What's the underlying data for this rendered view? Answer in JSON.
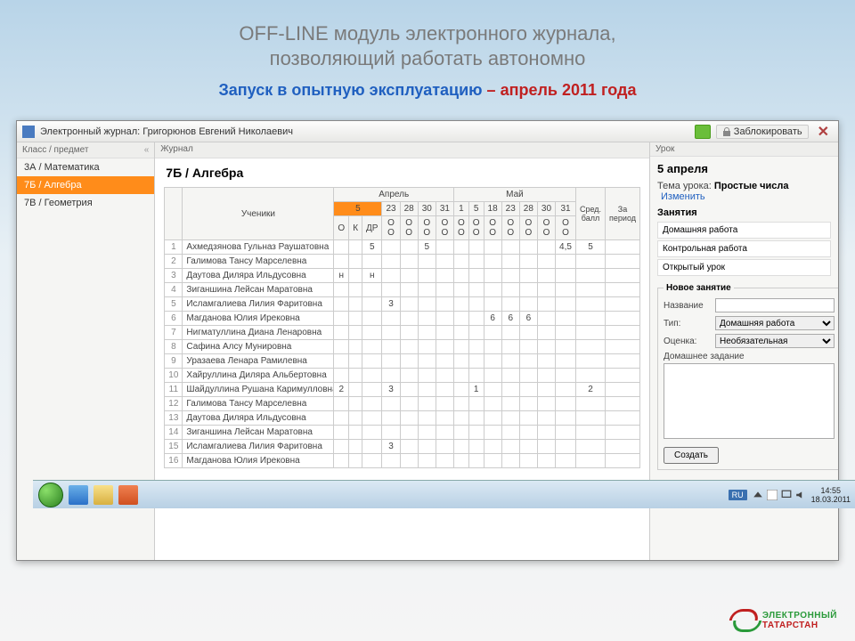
{
  "slide": {
    "title_line1": "OFF-LINE  модуль электронного журнала,",
    "title_line2": "позволяющий работать автономно",
    "subtitle_blue": "Запуск в опытную эксплуатацию",
    "subtitle_sep": " – ",
    "subtitle_red": "апрель 2011 года"
  },
  "app": {
    "title": "Электронный журнал: Григорюнов Евгений Николаевич",
    "lock_btn": "Заблокировать"
  },
  "sidebar": {
    "header": "Класс / предмет",
    "items": [
      {
        "label": "3А / Математика",
        "active": false
      },
      {
        "label": "7Б / Алгебра",
        "active": true
      },
      {
        "label": "7В / Геометрия",
        "active": false
      }
    ]
  },
  "main": {
    "tab_label": "Журнал",
    "title": "7Б / Алгебра",
    "students_header": "Ученики",
    "months": [
      "Апрель",
      "Май"
    ],
    "april_days": [
      "5",
      "23",
      "28",
      "30",
      "31"
    ],
    "may_days": [
      "1",
      "5",
      "18",
      "23",
      "28",
      "30",
      "31"
    ],
    "subhead": {
      "o": "О",
      "k": "К",
      "dr": "ДР",
      "oo": "О О"
    },
    "avg_header": "Сред. балл",
    "period_header": "За период",
    "rows": [
      {
        "n": "1",
        "name": "Ахмедзянова Гульназ Раушатовна",
        "cells": [
          "",
          "",
          "5",
          "",
          "",
          "5",
          "",
          "",
          "",
          "",
          "",
          "",
          "",
          "4,5",
          "5"
        ]
      },
      {
        "n": "2",
        "name": "Галимова Тансу Марселевна",
        "cells": [
          "",
          "",
          "",
          "",
          "",
          "",
          "",
          "",
          "",
          "",
          "",
          "",
          "",
          "",
          ""
        ]
      },
      {
        "n": "3",
        "name": "Даутова Диляра Ильдусовна",
        "cells": [
          "н",
          "",
          "н",
          "",
          "",
          "",
          "",
          "",
          "",
          "",
          "",
          "",
          "",
          "",
          ""
        ]
      },
      {
        "n": "4",
        "name": "Зиганшина Лейсан Маратовна",
        "cells": [
          "",
          "",
          "",
          "",
          "",
          "",
          "",
          "",
          "",
          "",
          "",
          "",
          "",
          "",
          ""
        ]
      },
      {
        "n": "5",
        "name": "Исламгалиева Лилия Фаритовна",
        "cells": [
          "",
          "",
          "",
          "3",
          "",
          "",
          "",
          "",
          "",
          "",
          "",
          "",
          "",
          "",
          ""
        ]
      },
      {
        "n": "6",
        "name": "Магданова Юлия Ирековна",
        "cells": [
          "",
          "",
          "",
          "",
          "",
          "",
          "",
          "",
          "",
          "6",
          "6",
          "6",
          "",
          "",
          ""
        ]
      },
      {
        "n": "7",
        "name": "Нигматуллина Диана Ленаровна",
        "cells": [
          "",
          "",
          "",
          "",
          "",
          "",
          "",
          "",
          "",
          "",
          "",
          "",
          "",
          "",
          ""
        ]
      },
      {
        "n": "8",
        "name": "Сафина Алсу Мунировна",
        "cells": [
          "",
          "",
          "",
          "",
          "",
          "",
          "",
          "",
          "",
          "",
          "",
          "",
          "",
          "",
          ""
        ]
      },
      {
        "n": "9",
        "name": "Уразаева Ленара Рамилевна",
        "cells": [
          "",
          "",
          "",
          "",
          "",
          "",
          "",
          "",
          "",
          "",
          "",
          "",
          "",
          "",
          ""
        ]
      },
      {
        "n": "10",
        "name": "Хайруллина Диляра Альбертовна",
        "cells": [
          "",
          "",
          "",
          "",
          "",
          "",
          "",
          "",
          "",
          "",
          "",
          "",
          "",
          "",
          ""
        ]
      },
      {
        "n": "11",
        "name": "Шайдуллина Рушана Каримулловна",
        "cells": [
          "2",
          "",
          "",
          "3",
          "",
          "",
          "",
          "",
          "1",
          "",
          "",
          "",
          "",
          "",
          "2"
        ]
      },
      {
        "n": "12",
        "name": "Галимова Тансу Марселевна",
        "cells": [
          "",
          "",
          "",
          "",
          "",
          "",
          "",
          "",
          "",
          "",
          "",
          "",
          "",
          "",
          ""
        ]
      },
      {
        "n": "13",
        "name": "Даутова Диляра Ильдусовна",
        "cells": [
          "",
          "",
          "",
          "",
          "",
          "",
          "",
          "",
          "",
          "",
          "",
          "",
          "",
          "",
          ""
        ]
      },
      {
        "n": "14",
        "name": "Зиганшина Лейсан Маратовна",
        "cells": [
          "",
          "",
          "",
          "",
          "",
          "",
          "",
          "",
          "",
          "",
          "",
          "",
          "",
          "",
          ""
        ]
      },
      {
        "n": "15",
        "name": "Исламгалиева Лилия Фаритовна",
        "cells": [
          "",
          "",
          "",
          "3",
          "",
          "",
          "",
          "",
          "",
          "",
          "",
          "",
          "",
          "",
          ""
        ]
      },
      {
        "n": "16",
        "name": "Магданова Юлия Ирековна",
        "cells": [
          "",
          "",
          "",
          "",
          "",
          "",
          "",
          "",
          "",
          "",
          "",
          "",
          "",
          "",
          ""
        ]
      }
    ]
  },
  "right": {
    "header": "Урок",
    "date": "5 апреля",
    "topic_label": "Тема урока:",
    "topic_value": "Простые числа",
    "change_link": "Изменить",
    "activities_title": "Занятия",
    "activities": [
      "Домашняя работа",
      "Контрольная работа",
      "Открытый урок"
    ],
    "new_activity_title": "Новое занятие",
    "fields": {
      "name_label": "Название",
      "type_label": "Тип:",
      "type_value": "Домашняя работа",
      "grade_label": "Оценка:",
      "grade_value": "Необязательная",
      "homework_label": "Домашнее задание"
    },
    "create_btn": "Создать"
  },
  "taskbar": {
    "lang": "RU",
    "time": "14:55",
    "date": "18.03.2011"
  },
  "logo": {
    "line1": "ЭЛЕКТРОННЫЙ",
    "line2": "ТАТАРСТАН"
  }
}
